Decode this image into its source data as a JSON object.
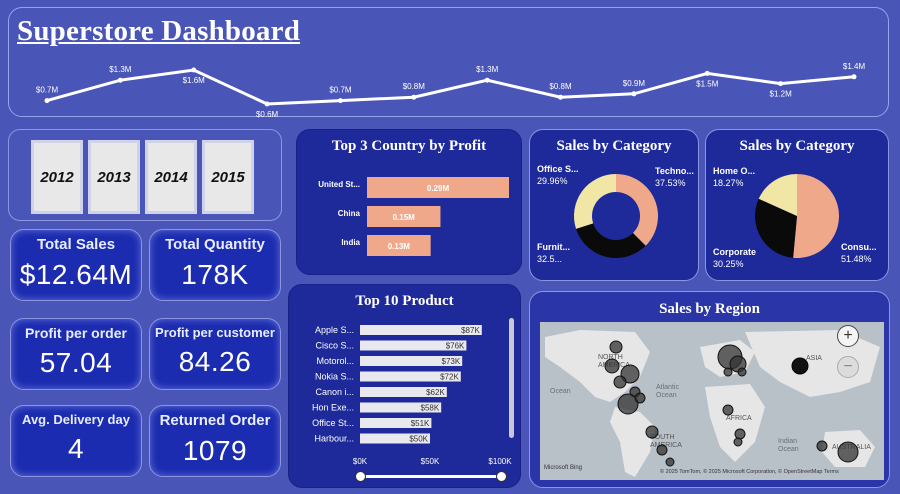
{
  "title": "Superstore Dashboard",
  "trend": {
    "labels": [
      "$0.7M",
      "$1.3M",
      "$1.6M",
      "$0.6M",
      "$0.7M",
      "$0.8M",
      "$1.3M",
      "$0.8M",
      "$0.9M",
      "$1.5M",
      "$1.2M",
      "$1.4M"
    ],
    "values": [
      0.7,
      1.3,
      1.6,
      0.6,
      0.7,
      0.8,
      1.3,
      0.8,
      0.9,
      1.5,
      1.2,
      1.4
    ]
  },
  "years": [
    "2012",
    "2013",
    "2014",
    "2015"
  ],
  "kpis": {
    "total_sales": {
      "label": "Total Sales",
      "value": "$12.64M"
    },
    "total_quantity": {
      "label": "Total Quantity",
      "value": "178K"
    },
    "profit_per_order": {
      "label": "Profit per order",
      "value": "57.04"
    },
    "profit_per_customer": {
      "label": "Profit per customer",
      "value": "84.26"
    },
    "avg_delivery": {
      "label": "Avg. Delivery day",
      "value": "4"
    },
    "returned_order": {
      "label": "Returned Order",
      "value": "1079"
    }
  },
  "top3": {
    "title": "Top 3 Country by Profit",
    "rows": [
      {
        "name": "United St...",
        "label": "0.29M",
        "value": 0.29
      },
      {
        "name": "China",
        "label": "0.15M",
        "value": 0.15
      },
      {
        "name": "India",
        "label": "0.13M",
        "value": 0.13
      }
    ]
  },
  "donut": {
    "title": "Sales by Category",
    "slices": [
      {
        "name": "Techno...",
        "pct": "37.53%",
        "value": 37.53,
        "color": "#f0a88a"
      },
      {
        "name": "Furnit...",
        "pct": "32.5...",
        "value": 32.51,
        "color": "#0a0a0a"
      },
      {
        "name": "Office S...",
        "pct": "29.96%",
        "value": 29.96,
        "color": "#f2e6a6"
      }
    ]
  },
  "pie": {
    "title": "Sales by Category",
    "slices": [
      {
        "name": "Consu...",
        "pct": "51.48%",
        "value": 51.48,
        "color": "#f0a88a"
      },
      {
        "name": "Corporate",
        "pct": "30.25%",
        "value": 30.25,
        "color": "#0a0a0a"
      },
      {
        "name": "Home O...",
        "pct": "18.27%",
        "value": 18.27,
        "color": "#f2e6a6"
      }
    ]
  },
  "top10": {
    "title": "Top 10 Product",
    "rows": [
      {
        "name": "Apple S...",
        "label": "$87K",
        "value": 87
      },
      {
        "name": "Cisco S...",
        "label": "$76K",
        "value": 76
      },
      {
        "name": "Motorol...",
        "label": "$73K",
        "value": 73
      },
      {
        "name": "Nokia S...",
        "label": "$72K",
        "value": 72
      },
      {
        "name": "Canon i...",
        "label": "$62K",
        "value": 62
      },
      {
        "name": "Hon Exe...",
        "label": "$58K",
        "value": 58
      },
      {
        "name": "Office St...",
        "label": "$51K",
        "value": 51
      },
      {
        "name": "Harbour...",
        "label": "$50K",
        "value": 50
      }
    ],
    "axis": [
      "$0K",
      "$50K",
      "$100K"
    ],
    "max": 100
  },
  "region": {
    "title": "Sales by Region",
    "labels": {
      "north_america": "NORTH AMERICA",
      "south_america": "SOUTH AMERICA",
      "africa": "AFRICA",
      "asia": "ASIA",
      "australia": "AUSTRALIA",
      "atlantic": "Atlantic Ocean",
      "indian": "Indian Ocean",
      "ocean_left": "Ocean"
    },
    "bing": "Microsoft Bing",
    "copyright": "© 2025 TomTom, © 2025 Microsoft Corporation, © OpenStreetMap  Terms",
    "zoom_in": "+",
    "zoom_out": "−"
  },
  "colors": {
    "bar": "#f0a88a",
    "product_bar": "#e8e8ee",
    "background": "#4a55b8",
    "panel": "#2c38a8"
  }
}
